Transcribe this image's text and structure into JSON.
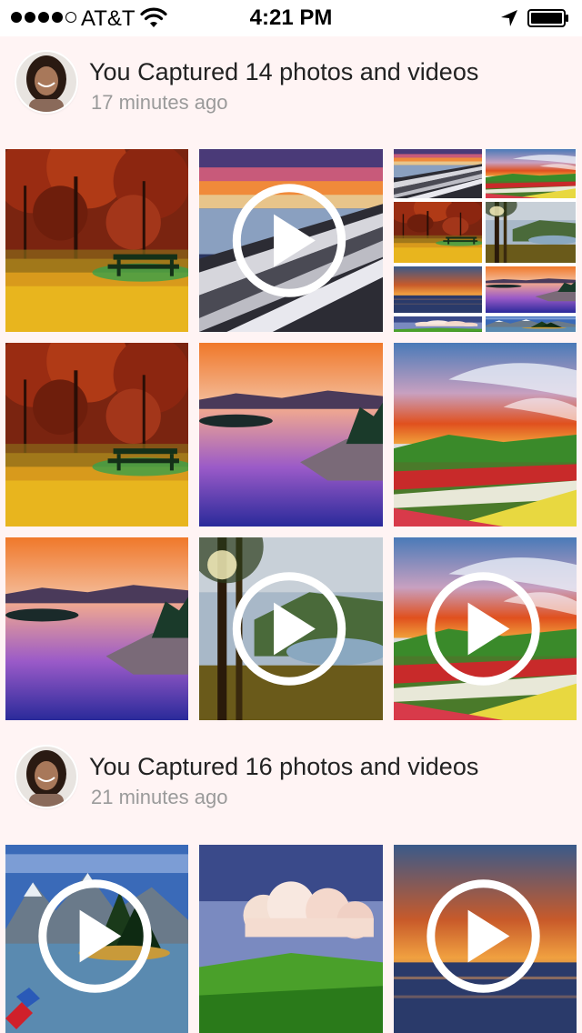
{
  "status_bar": {
    "carrier": "AT&T",
    "time": "4:21 PM",
    "signal_bars_filled": 4,
    "signal_bars_total": 5,
    "icons": [
      "wifi-icon",
      "location-arrow-icon",
      "battery-icon"
    ]
  },
  "feed": [
    {
      "title": "You Captured 14 photos and videos",
      "subtitle": "17 minutes ago",
      "avatar": "user-avatar",
      "items": [
        {
          "kind": "photo",
          "scene": "autumn-bench"
        },
        {
          "kind": "video",
          "scene": "sunset-pier"
        },
        {
          "kind": "collage",
          "scene": "multi-photo"
        },
        {
          "kind": "photo",
          "scene": "autumn-bench"
        },
        {
          "kind": "photo",
          "scene": "lake-sunset"
        },
        {
          "kind": "photo",
          "scene": "flower-field-sky"
        },
        {
          "kind": "photo",
          "scene": "lake-sunset"
        },
        {
          "kind": "video",
          "scene": "forest-lake"
        },
        {
          "kind": "video",
          "scene": "flower-field-sky"
        }
      ]
    },
    {
      "title": "You Captured 16 photos and videos",
      "subtitle": "21 minutes ago",
      "avatar": "user-avatar",
      "items": [
        {
          "kind": "video",
          "scene": "mountain-lake"
        },
        {
          "kind": "photo",
          "scene": "green-hills-clouds"
        },
        {
          "kind": "video",
          "scene": "ocean-sunset"
        }
      ]
    }
  ],
  "colors": {
    "group_background": "#fff4f4",
    "title_text": "#222222",
    "subtitle_text": "#9a9a9a"
  }
}
